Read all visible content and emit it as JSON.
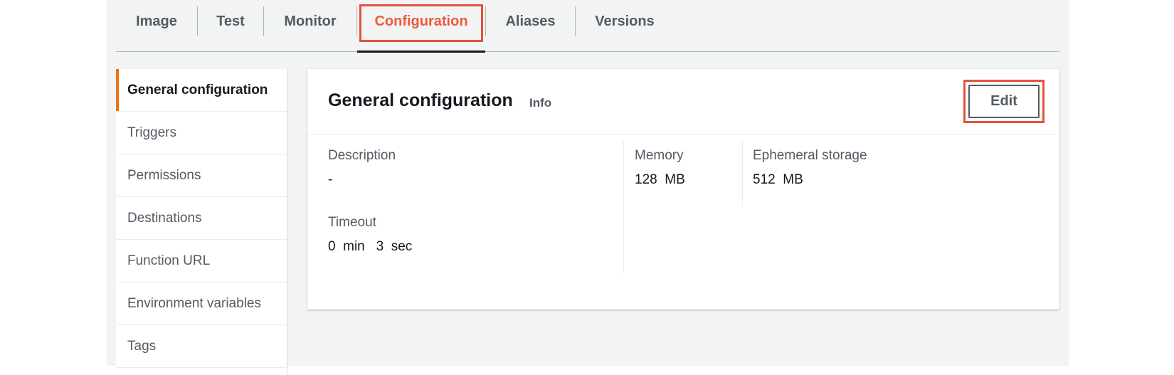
{
  "tabs": [
    {
      "label": "Image",
      "active": false
    },
    {
      "label": "Test",
      "active": false
    },
    {
      "label": "Monitor",
      "active": false
    },
    {
      "label": "Configuration",
      "active": true
    },
    {
      "label": "Aliases",
      "active": false
    },
    {
      "label": "Versions",
      "active": false
    }
  ],
  "sidenav": {
    "items": [
      {
        "label": "General configuration",
        "active": true
      },
      {
        "label": "Triggers",
        "active": false
      },
      {
        "label": "Permissions",
        "active": false
      },
      {
        "label": "Destinations",
        "active": false
      },
      {
        "label": "Function URL",
        "active": false
      },
      {
        "label": "Environment variables",
        "active": false
      },
      {
        "label": "Tags",
        "active": false
      }
    ]
  },
  "panel": {
    "title": "General configuration",
    "info_label": "Info",
    "edit_label": "Edit",
    "fields": {
      "description": {
        "label": "Description",
        "value": "-"
      },
      "timeout": {
        "label": "Timeout",
        "value": "0  min   3  sec"
      },
      "memory": {
        "label": "Memory",
        "value": "128  MB"
      },
      "ephemeral_storage": {
        "label": "Ephemeral storage",
        "value": "512  MB"
      }
    }
  },
  "colors": {
    "accent_highlight": "#e3533b",
    "active_tab_text": "#ec5b3b",
    "nav_active_bar": "#ec7211",
    "background": "#f2f3f3"
  }
}
